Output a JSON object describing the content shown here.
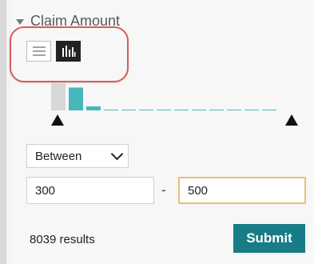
{
  "filter": {
    "title": "Claim Amount",
    "mode_options": [
      "list-view-icon",
      "histogram-view-icon"
    ],
    "selected_mode": "histogram-view-icon",
    "operator": "Between",
    "min_value": "300",
    "max_value": "500",
    "results_text": "8039 results",
    "submit_label": "Submit"
  },
  "colors": {
    "accent": "#177c86",
    "highlight": "#db5b5b",
    "bar_gray": "#d8d8d8",
    "bar_teal": "#46b8bc",
    "max_input_border": "#e6c178"
  },
  "histogram": {
    "bars": [
      0.82,
      0.68,
      0.12,
      0.02,
      0.02,
      0.02,
      0.02,
      0.02,
      0.02,
      0.02,
      0.02,
      0.02,
      0.02
    ],
    "selected_start": 0,
    "selected_end": 1
  }
}
